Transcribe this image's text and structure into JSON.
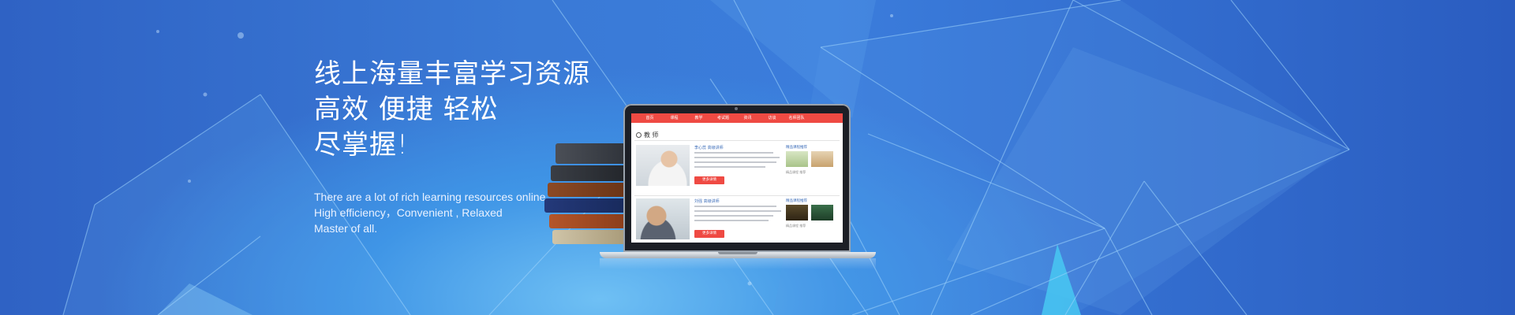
{
  "headline": {
    "line1": "线上海量丰富学习资源",
    "line2": "高效 便捷 轻松",
    "line3": "尽掌握!"
  },
  "subline": {
    "line1": "There are a lot of rich learning resources online",
    "line2": "High efficiency，Convenient , Relaxed",
    "line3": "Master of all."
  },
  "screen": {
    "nav": [
      "首页",
      "课程",
      "教学",
      "考试题",
      "资讯",
      "访谈",
      "名师团队"
    ],
    "section_title": "教 师",
    "rows": [
      {
        "title": "李心蕊  高级讲师",
        "more": "更多详情",
        "side_title": "精品课程推荐",
        "side_text": "精品课程 推荐"
      },
      {
        "title": "刘强  高级讲师",
        "more": "更多详情",
        "side_title": "精品课程推荐",
        "side_text": "精品课程 推荐"
      }
    ]
  },
  "colors": {
    "bg_dark": "#2a5cc0",
    "bg_light": "#6fc0f4",
    "nav_red": "#ef4a43",
    "text_white": "#ffffff"
  }
}
